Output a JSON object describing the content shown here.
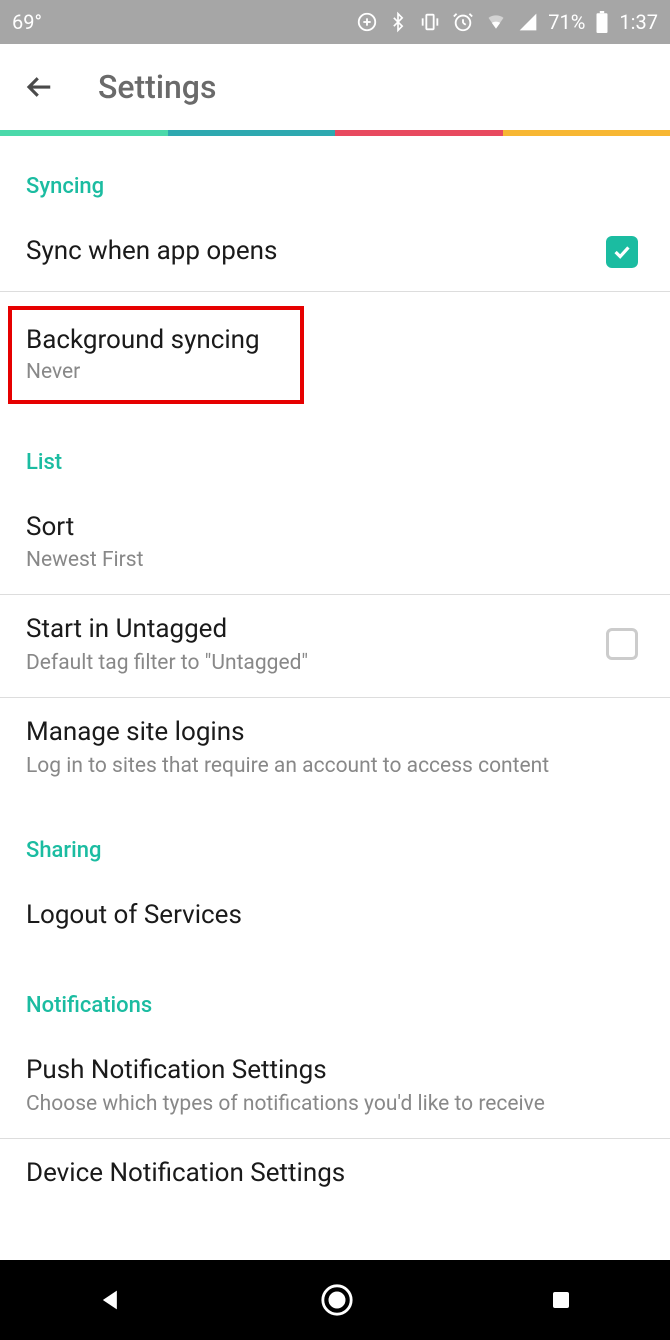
{
  "status": {
    "temp": "69°",
    "battery": "71%",
    "time": "1:37"
  },
  "header": {
    "title": "Settings"
  },
  "sections": {
    "syncing": {
      "label": "Syncing",
      "sync_open": {
        "title": "Sync when app opens",
        "checked": true
      },
      "bg_sync": {
        "title": "Background syncing",
        "value": "Never"
      }
    },
    "list": {
      "label": "List",
      "sort": {
        "title": "Sort",
        "value": "Newest First"
      },
      "untagged": {
        "title": "Start in Untagged",
        "sub": "Default tag filter to \"Untagged\"",
        "checked": false
      },
      "logins": {
        "title": "Manage site logins",
        "sub": "Log in to sites that require an account to access content"
      }
    },
    "sharing": {
      "label": "Sharing",
      "logout": {
        "title": "Logout of Services"
      }
    },
    "notifications": {
      "label": "Notifications",
      "push": {
        "title": "Push Notification Settings",
        "sub": "Choose which types of notifications you'd like to receive"
      },
      "device": {
        "title": "Device Notification Settings"
      }
    }
  }
}
